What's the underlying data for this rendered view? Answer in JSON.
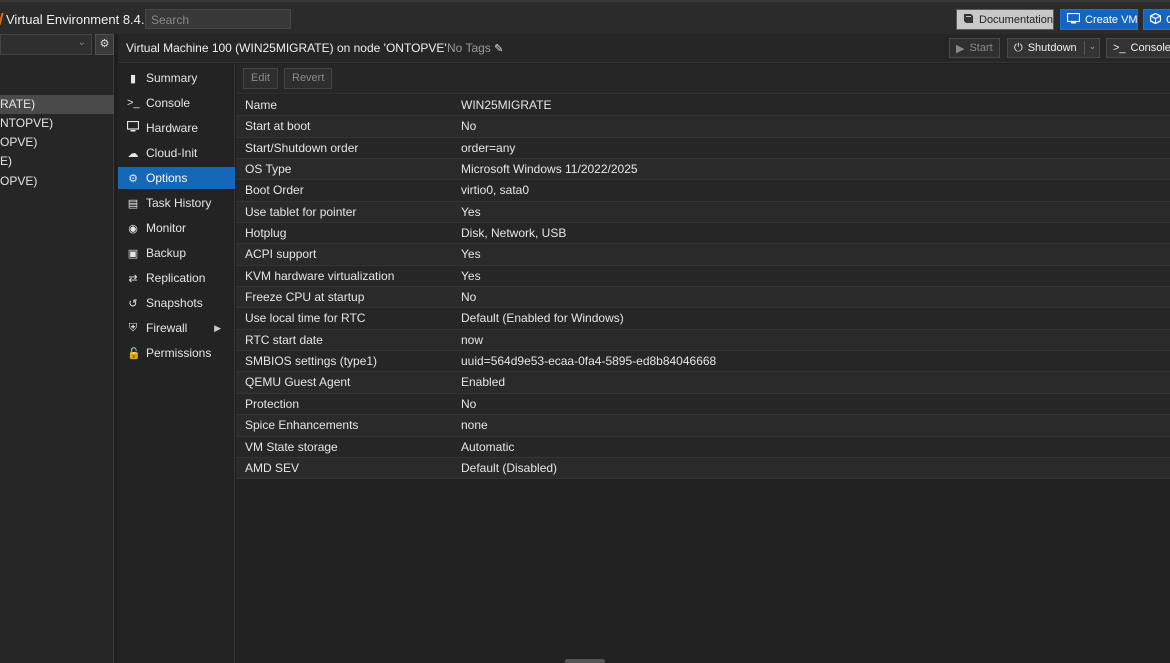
{
  "header": {
    "title": "Virtual Environment 8.4.1",
    "search_placeholder": "Search",
    "documentation_label": "Documentation",
    "create_vm_label": "Create VM",
    "create_ct_label": "C"
  },
  "tree": {
    "items": [
      "RATE)",
      "NTOPVE)",
      "OPVE)",
      "E)",
      "OPVE)"
    ]
  },
  "vm": {
    "title": "Virtual Machine 100 (WIN25MIGRATE) on node 'ONTOPVE'",
    "tags": "No Tags",
    "start_label": "Start",
    "shutdown_label": "Shutdown",
    "console_label": "Console"
  },
  "nav": {
    "items": [
      {
        "label": "Summary",
        "icon": "book-icon"
      },
      {
        "label": "Console",
        "icon": "terminal-icon"
      },
      {
        "label": "Hardware",
        "icon": "monitor-icon"
      },
      {
        "label": "Cloud-Init",
        "icon": "cloud-icon"
      },
      {
        "label": "Options",
        "icon": "gear-icon"
      },
      {
        "label": "Task History",
        "icon": "list-icon"
      },
      {
        "label": "Monitor",
        "icon": "eye-icon"
      },
      {
        "label": "Backup",
        "icon": "floppy-icon"
      },
      {
        "label": "Replication",
        "icon": "retweet-icon"
      },
      {
        "label": "Snapshots",
        "icon": "history-icon"
      },
      {
        "label": "Firewall",
        "icon": "shield-icon"
      },
      {
        "label": "Permissions",
        "icon": "unlock-icon"
      }
    ]
  },
  "toolbar": {
    "edit_label": "Edit",
    "revert_label": "Revert"
  },
  "options": [
    {
      "key": "Name",
      "value": "WIN25MIGRATE"
    },
    {
      "key": "Start at boot",
      "value": "No"
    },
    {
      "key": "Start/Shutdown order",
      "value": "order=any"
    },
    {
      "key": "OS Type",
      "value": "Microsoft Windows 11/2022/2025"
    },
    {
      "key": "Boot Order",
      "value": "virtio0, sata0"
    },
    {
      "key": "Use tablet for pointer",
      "value": "Yes"
    },
    {
      "key": "Hotplug",
      "value": "Disk, Network, USB"
    },
    {
      "key": "ACPI support",
      "value": "Yes"
    },
    {
      "key": "KVM hardware virtualization",
      "value": "Yes"
    },
    {
      "key": "Freeze CPU at startup",
      "value": "No"
    },
    {
      "key": "Use local time for RTC",
      "value": "Default (Enabled for Windows)"
    },
    {
      "key": "RTC start date",
      "value": "now"
    },
    {
      "key": "SMBIOS settings (type1)",
      "value": "uuid=564d9e53-ecaa-0fa4-5895-ed8b84046668"
    },
    {
      "key": "QEMU Guest Agent",
      "value": "Enabled"
    },
    {
      "key": "Protection",
      "value": "No"
    },
    {
      "key": "Spice Enhancements",
      "value": "none"
    },
    {
      "key": "VM State storage",
      "value": "Automatic"
    },
    {
      "key": "AMD SEV",
      "value": "Default (Disabled)"
    }
  ],
  "colors": {
    "accent": "#1567b8",
    "create_button": "#1565c0",
    "background": "#1f1f1f"
  }
}
